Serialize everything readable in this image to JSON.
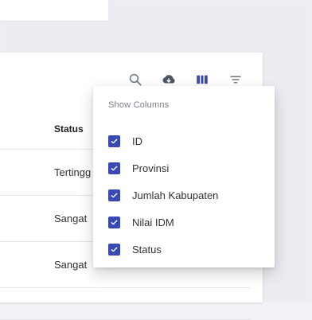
{
  "toolbar": {
    "search_icon": "search-icon",
    "download_icon": "cloud-download-icon",
    "columns_icon": "view-column-icon",
    "filter_icon": "filter-icon",
    "accent": "#3848b5"
  },
  "table": {
    "header": {
      "status": "Status"
    },
    "rows": [
      {
        "status": "Tertingg"
      },
      {
        "status": "Sangat"
      },
      {
        "status": "Sangat"
      }
    ]
  },
  "popover": {
    "title": "Show Columns",
    "options": [
      {
        "label": "ID",
        "checked": true
      },
      {
        "label": "Provinsi",
        "checked": true
      },
      {
        "label": "Jumlah Kabupaten",
        "checked": true
      },
      {
        "label": "Nilai IDM",
        "checked": true
      },
      {
        "label": "Status",
        "checked": true
      }
    ]
  }
}
